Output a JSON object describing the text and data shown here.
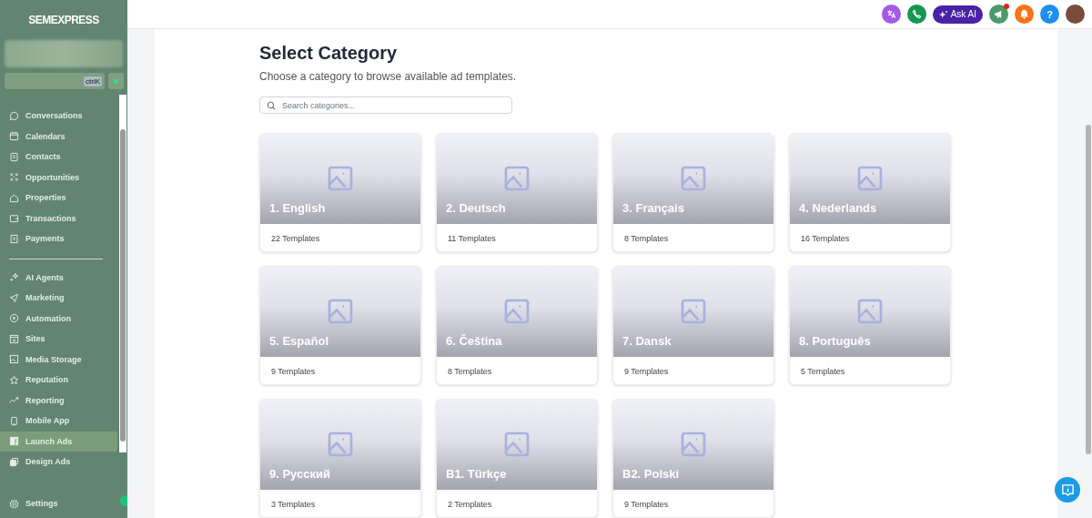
{
  "sidebar": {
    "logo": "SEMEXPRESS",
    "search_shortcut": "ctrlK",
    "items": [
      {
        "label": "Conversations",
        "kind": "chat",
        "selected": false
      },
      {
        "label": "Calendars",
        "kind": "calendar",
        "selected": false
      },
      {
        "label": "Contacts",
        "kind": "contacts",
        "selected": false
      },
      {
        "label": "Opportunities",
        "kind": "grid",
        "selected": false
      },
      {
        "label": "Properties",
        "kind": "house",
        "selected": false
      },
      {
        "label": "Transactions",
        "kind": "wallet",
        "selected": false
      },
      {
        "label": "Payments",
        "kind": "receipt",
        "selected": false
      }
    ],
    "tools": [
      {
        "label": "AI Agents",
        "kind": "sparkle",
        "selected": false
      },
      {
        "label": "Marketing",
        "kind": "send",
        "selected": false
      },
      {
        "label": "Automation",
        "kind": "play",
        "selected": false
      },
      {
        "label": "Sites",
        "kind": "site",
        "selected": false
      },
      {
        "label": "Media Storage",
        "kind": "image",
        "selected": false
      },
      {
        "label": "Reputation",
        "kind": "star",
        "selected": false
      },
      {
        "label": "Reporting",
        "kind": "trend",
        "selected": false
      },
      {
        "label": "Mobile App",
        "kind": "phone",
        "selected": false
      },
      {
        "label": "Launch Ads",
        "kind": "fb",
        "selected": true
      },
      {
        "label": "Design Ads",
        "kind": "layers",
        "selected": false
      }
    ],
    "settings": "Settings"
  },
  "topbar": {
    "ask_ai": "Ask AI",
    "help": "?",
    "unread": true
  },
  "page": {
    "title": "Select Category",
    "subtitle": "Choose a category to browse available ad templates.",
    "search_placeholder": "Search categories..."
  },
  "categories": [
    {
      "name": "1. English",
      "count": "22 Templates"
    },
    {
      "name": "2. Deutsch",
      "count": "11 Templates"
    },
    {
      "name": "3. Français",
      "count": "8 Templates"
    },
    {
      "name": "4. Nederlands",
      "count": "16 Templates"
    },
    {
      "name": "5. Español",
      "count": "9 Templates"
    },
    {
      "name": "6. Čeština",
      "count": "8 Templates"
    },
    {
      "name": "7. Dansk",
      "count": "9 Templates"
    },
    {
      "name": "8. Português",
      "count": "5 Templates"
    },
    {
      "name": "9. Русский",
      "count": "3 Templates"
    },
    {
      "name": "B1. Türkçe",
      "count": "2 Templates"
    },
    {
      "name": "B2. Polski",
      "count": "9 Templates"
    }
  ]
}
